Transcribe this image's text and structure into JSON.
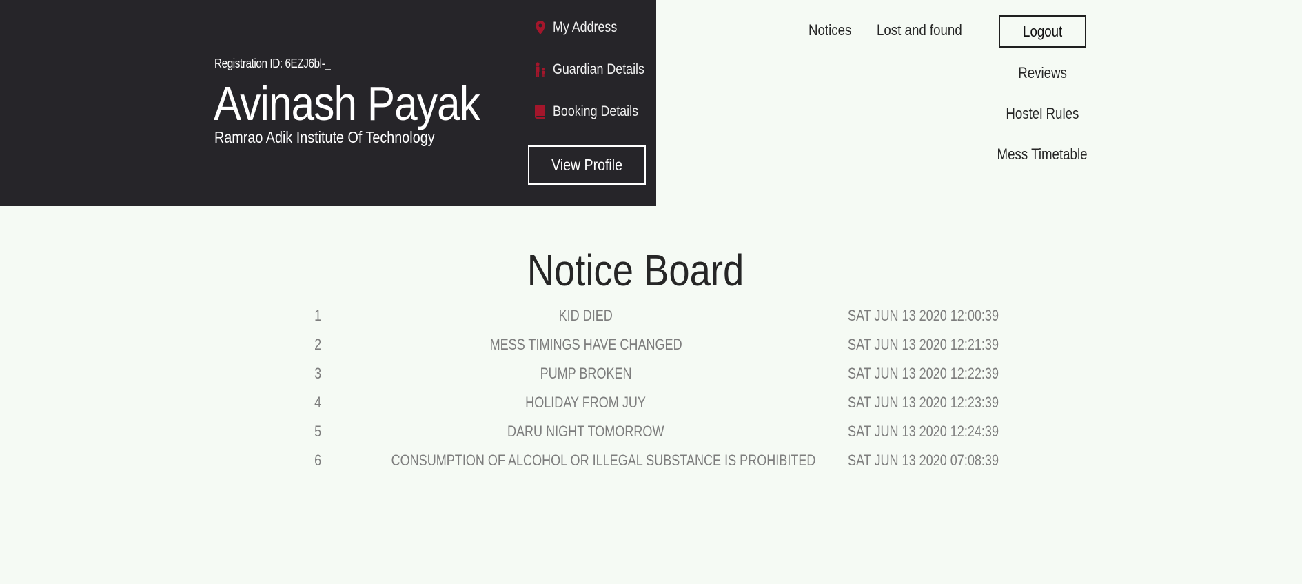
{
  "profile": {
    "registration_id": "Registration ID: 6EZJ6bl-_",
    "name": "Avinash Payak",
    "institute": "Ramrao Adik Institute Of Technology",
    "links": {
      "address": "My Address",
      "guardian": "Guardian Details",
      "booking": "Booking Details"
    },
    "view_profile": "View Profile",
    "accent_color": "#a3162b",
    "card_color": "#262529"
  },
  "nav": {
    "notices": "Notices",
    "lost_and_found": "Lost and found",
    "logout": "Logout",
    "reviews": "Reviews",
    "hostel_rules": "Hostel Rules",
    "mess_timetable": "Mess Timetable"
  },
  "notice_board": {
    "title": "Notice Board",
    "rows": [
      {
        "num": "1",
        "title": "KID DIED",
        "date": "SAT JUN 13 2020 12:00:39"
      },
      {
        "num": "2",
        "title": "MESS TIMINGS HAVE CHANGED",
        "date": "SAT JUN 13 2020 12:21:39"
      },
      {
        "num": "3",
        "title": "PUMP BROKEN",
        "date": "SAT JUN 13 2020 12:22:39"
      },
      {
        "num": "4",
        "title": "HOLIDAY FROM JUY",
        "date": "SAT JUN 13 2020 12:23:39"
      },
      {
        "num": "5",
        "title": "DARU NIGHT TOMORROW",
        "date": "SAT JUN 13 2020 12:24:39"
      },
      {
        "num": "6",
        "title": "CONSUMPTION OF ALCOHOL OR ILLEGAL SUBSTANCE IS PROHIBITED",
        "date": "SAT JUN 13 2020 07:08:39"
      }
    ]
  }
}
